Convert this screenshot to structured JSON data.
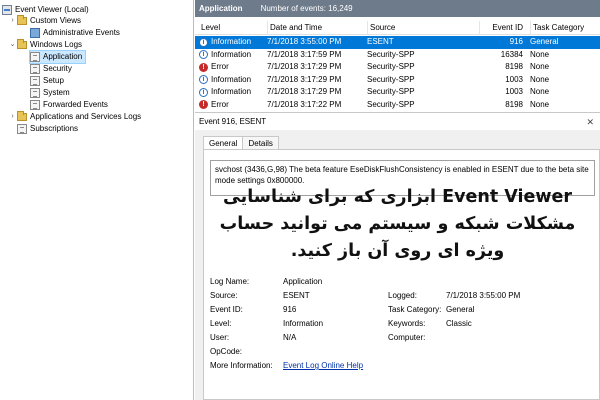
{
  "tree": {
    "root": "Event Viewer (Local)",
    "custom_views": "Custom Views",
    "admin_events": "Administrative Events",
    "windows_logs": "Windows Logs",
    "application": "Application",
    "security": "Security",
    "setup": "Setup",
    "system": "System",
    "forwarded": "Forwarded Events",
    "apps_services": "Applications and Services Logs",
    "subscriptions": "Subscriptions"
  },
  "header": {
    "title": "Application",
    "count": "Number of events: 16,249"
  },
  "table": {
    "columns": {
      "level": "Level",
      "date": "Date and Time",
      "source": "Source",
      "event_id": "Event ID",
      "category": "Task Category"
    },
    "rows": [
      {
        "level": "Information",
        "date": "7/1/2018 3:55:00 PM",
        "source": "ESENT",
        "event_id": "916",
        "category": "General"
      },
      {
        "level": "Information",
        "date": "7/1/2018 3:17:59 PM",
        "source": "Security-SPP",
        "event_id": "16384",
        "category": "None"
      },
      {
        "level": "Error",
        "date": "7/1/2018 3:17:29 PM",
        "source": "Security-SPP",
        "event_id": "8198",
        "category": "None"
      },
      {
        "level": "Information",
        "date": "7/1/2018 3:17:29 PM",
        "source": "Security-SPP",
        "event_id": "1003",
        "category": "None"
      },
      {
        "level": "Information",
        "date": "7/1/2018 3:17:29 PM",
        "source": "Security-SPP",
        "event_id": "1003",
        "category": "None"
      },
      {
        "level": "Error",
        "date": "7/1/2018 3:17:22 PM",
        "source": "Security-SPP",
        "event_id": "8198",
        "category": "None"
      }
    ]
  },
  "details": {
    "title": "Event 916, ESENT",
    "close": "✕",
    "tabs": {
      "general": "General",
      "details": "Details"
    },
    "message": "svchost (3436,G,98) The beta feature EseDiskFlushConsistency is enabled in ESENT due to the beta site mode settings 0x800000."
  },
  "overlay": {
    "line1": "Event Viewer ابزاری که برای شناسایی",
    "line2": "مشکلات شبکه و سیستم می توانید حساب",
    "line3": "ویژه ای روی آن باز کنید."
  },
  "properties": {
    "log_name_label": "Log Name:",
    "log_name": "Application",
    "source_label": "Source:",
    "source": "ESENT",
    "logged_label": "Logged:",
    "logged": "7/1/2018 3:55:00 PM",
    "event_id_label": "Event ID:",
    "event_id": "916",
    "task_label": "Task Category:",
    "task": "General",
    "level_label": "Level:",
    "level": "Information",
    "keywords_label": "Keywords:",
    "keywords": "Classic",
    "user_label": "User:",
    "user": "N/A",
    "computer_label": "Computer:",
    "computer": "",
    "opcode_label": "OpCode:",
    "opcode": "",
    "more_info_label": "More Information:",
    "more_info": "Event Log Online Help"
  },
  "colors": {
    "header": "#6e7b8b",
    "selection": "#0078d7",
    "tree_selection": "#cce8ff",
    "link": "#0033aa",
    "error": "#c62b2b",
    "info": "#2a6fc0"
  }
}
